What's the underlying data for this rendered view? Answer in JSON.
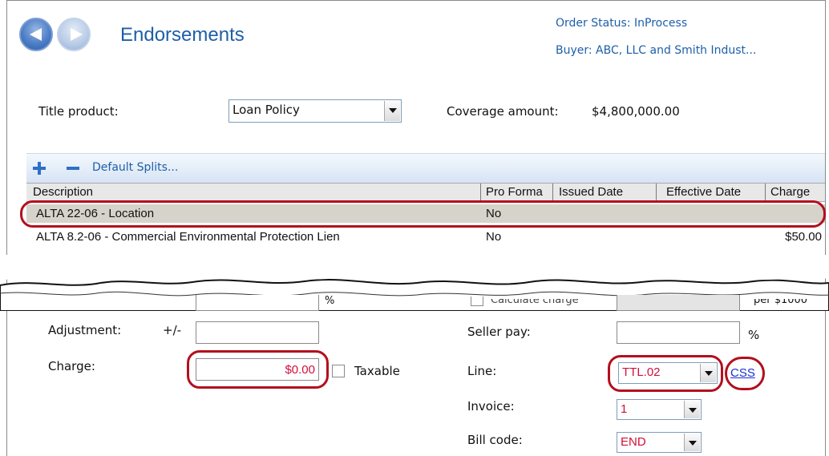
{
  "header": {
    "title": "Endorsements",
    "order_status": "Order Status: InProcess",
    "buyer": "Buyer: ABC, LLC and Smith Indust..."
  },
  "product": {
    "title_product_label": "Title product:",
    "title_product_value": "Loan Policy",
    "coverage_label": "Coverage amount:",
    "coverage_value": "$4,800,000.00"
  },
  "toolbar": {
    "default_splits_label": "Default Splits..."
  },
  "grid": {
    "columns": [
      "Description",
      "Pro Forma",
      "Issued Date",
      "Effective Date",
      "Charge"
    ],
    "rows": [
      {
        "description": "ALTA 22-06 - Location",
        "pro_forma": "No",
        "issued_date": "",
        "effective_date": "",
        "charge": ""
      },
      {
        "description": "ALTA 8.2-06 - Commercial Environmental Protection Lien",
        "pro_forma": "No",
        "issued_date": "",
        "effective_date": "",
        "charge": "$50.00"
      }
    ]
  },
  "form": {
    "partial_percent": "%",
    "calculate_charge_label": "Calculate charge",
    "per_label": "per $1000",
    "adjustment_label": "Adjustment:",
    "adjustment_sign": "+/-",
    "adjustment_value": "",
    "charge_label": "Charge:",
    "charge_value": "$0.00",
    "taxable_label": "Taxable",
    "seller_pay_label": "Seller pay:",
    "seller_pay_value": "",
    "seller_pay_percent": "%",
    "line_label": "Line:",
    "line_value": "TTL.02",
    "css_link": "CSS",
    "invoice_label": "Invoice:",
    "invoice_value": "1",
    "bill_code_label": "Bill code:",
    "bill_code_value": "END"
  },
  "colors": {
    "accent_blue": "#1e5fa8",
    "highlight_red": "#b30f1e",
    "value_red": "#d1103a",
    "selected_row": "#d6d3cb"
  }
}
